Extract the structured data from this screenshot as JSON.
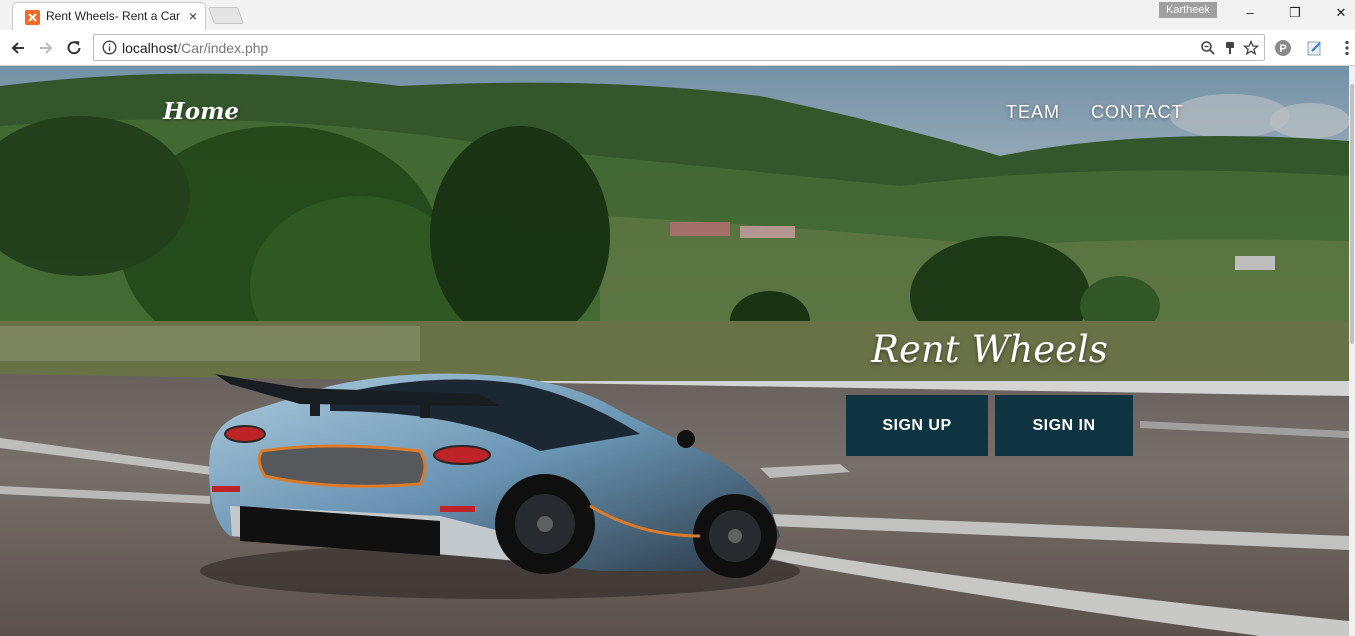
{
  "browser": {
    "tab_title": "Rent Wheels- Rent a Car",
    "tab_close": "×",
    "profile_name": "Kartheek",
    "url_host": "localhost",
    "url_path": "/Car/index.php",
    "window_controls": {
      "minimize": "–",
      "maximize": "❐",
      "close": "✕"
    },
    "icons": [
      "back-icon",
      "forward-icon",
      "reload-icon",
      "info-icon",
      "zoom-icon",
      "key-icon",
      "star-icon",
      "extension-p-icon",
      "extension-edit-icon",
      "menu-dots-icon"
    ]
  },
  "nav": {
    "brand": "Home",
    "links": [
      "TEAM",
      "CONTACT"
    ]
  },
  "hero": {
    "title": "Rent Wheels",
    "buttons": [
      "SIGN UP",
      "SIGN IN"
    ],
    "accent_color": "#0d3440"
  }
}
